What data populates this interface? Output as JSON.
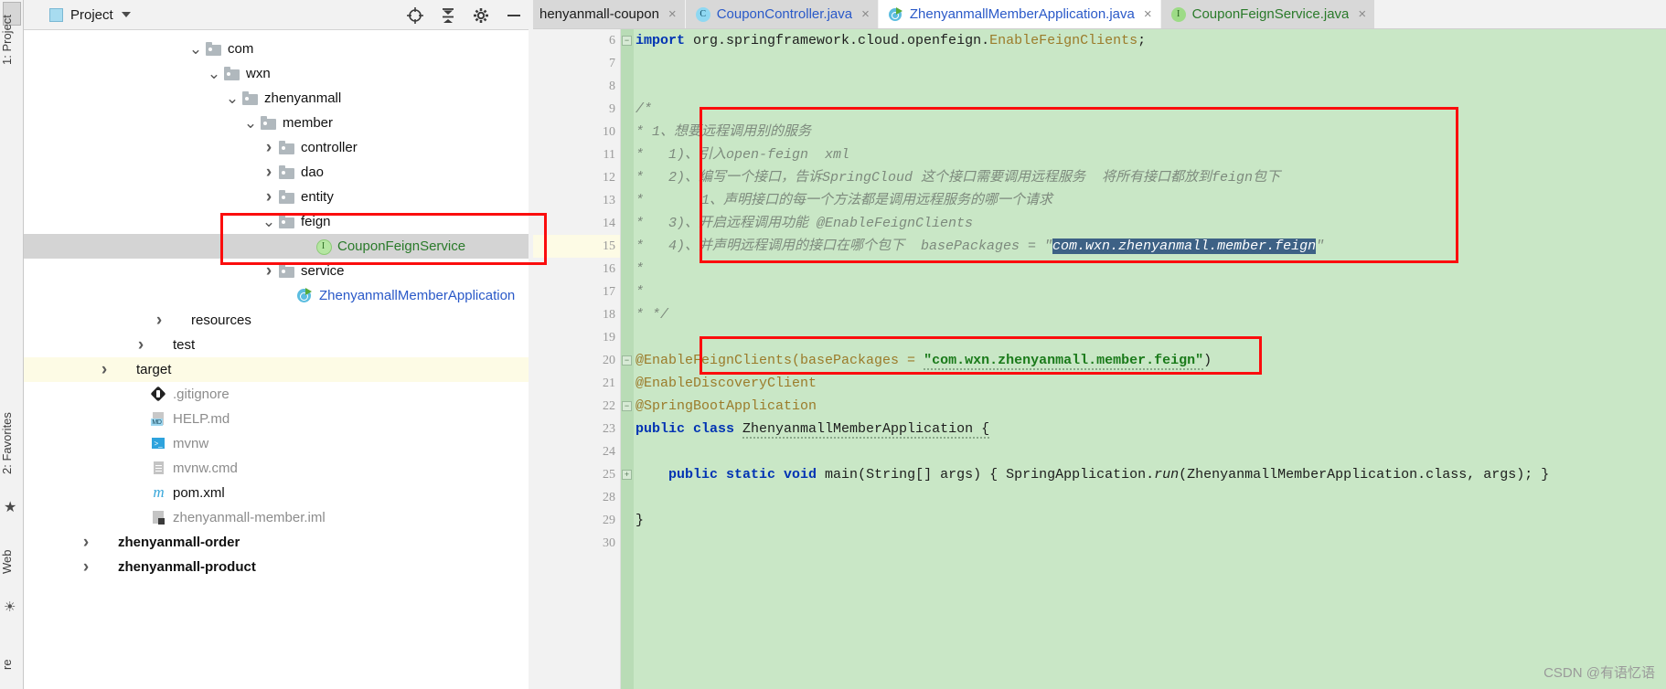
{
  "left_strip": {
    "project_label": "1: Project",
    "favorites_label": "2: Favorites",
    "web_label": "Web",
    "structure_label": "re",
    "star_icon": "star-icon",
    "globe_icon": "globe-icon"
  },
  "project_panel": {
    "title": "Project",
    "dropdown_icon": "chevron-down-icon",
    "actions": [
      {
        "name": "locate-icon",
        "glyph": "⊕"
      },
      {
        "name": "collapse-all-icon",
        "glyph": "⇹"
      },
      {
        "name": "settings-gear-icon",
        "glyph": "⚙"
      },
      {
        "name": "hide-panel-icon",
        "glyph": "—"
      }
    ],
    "tree": [
      {
        "label": "com",
        "indent": 9,
        "arrow": "down",
        "icon": "folder",
        "color": "",
        "state": ""
      },
      {
        "label": "wxn",
        "indent": 10,
        "arrow": "down",
        "icon": "folder",
        "color": "",
        "state": ""
      },
      {
        "label": "zhenyanmall",
        "indent": 11,
        "arrow": "down",
        "icon": "folder",
        "color": "",
        "state": ""
      },
      {
        "label": "member",
        "indent": 12,
        "arrow": "down",
        "icon": "folder",
        "color": "",
        "state": ""
      },
      {
        "label": "controller",
        "indent": 13,
        "arrow": "right",
        "icon": "folder",
        "color": "",
        "state": ""
      },
      {
        "label": "dao",
        "indent": 13,
        "arrow": "right",
        "icon": "folder",
        "color": "",
        "state": ""
      },
      {
        "label": "entity",
        "indent": 13,
        "arrow": "right",
        "icon": "folder",
        "color": "",
        "state": ""
      },
      {
        "label": "feign",
        "indent": 13,
        "arrow": "down",
        "icon": "folder",
        "color": "",
        "state": ""
      },
      {
        "label": "CouponFeignService",
        "indent": 15,
        "arrow": "none",
        "icon": "iface",
        "color": "green",
        "state": "selected"
      },
      {
        "label": "service",
        "indent": 13,
        "arrow": "right",
        "icon": "folder",
        "color": "",
        "state": ""
      },
      {
        "label": "ZhenyanmallMemberApplication",
        "indent": 14,
        "arrow": "none",
        "icon": "spring",
        "color": "blue",
        "state": ""
      },
      {
        "label": "resources",
        "indent": 7,
        "arrow": "right",
        "icon": "folder-res",
        "color": "",
        "state": ""
      },
      {
        "label": "test",
        "indent": 6,
        "arrow": "right",
        "icon": "folder-plain",
        "color": "",
        "state": ""
      },
      {
        "label": "target",
        "indent": 4,
        "arrow": "right",
        "icon": "folder-orange",
        "color": "",
        "state": "highlight"
      },
      {
        "label": ".gitignore",
        "indent": 6,
        "arrow": "none",
        "icon": "git",
        "color": "grey",
        "state": ""
      },
      {
        "label": "HELP.md",
        "indent": 6,
        "arrow": "none",
        "icon": "md",
        "color": "grey",
        "state": ""
      },
      {
        "label": "mvnw",
        "indent": 6,
        "arrow": "none",
        "icon": "sh",
        "color": "grey",
        "state": ""
      },
      {
        "label": "mvnw.cmd",
        "indent": 6,
        "arrow": "none",
        "icon": "file",
        "color": "grey",
        "state": ""
      },
      {
        "label": "pom.xml",
        "indent": 6,
        "arrow": "none",
        "icon": "maven",
        "color": "",
        "state": ""
      },
      {
        "label": "zhenyanmall-member.iml",
        "indent": 6,
        "arrow": "none",
        "icon": "iml",
        "color": "grey",
        "state": ""
      },
      {
        "label": "zhenyanmall-order",
        "indent": 3,
        "arrow": "right",
        "icon": "folder-mod",
        "color": "bold",
        "state": ""
      },
      {
        "label": "zhenyanmall-product",
        "indent": 3,
        "arrow": "right",
        "icon": "folder-mod",
        "color": "bold",
        "state": ""
      }
    ],
    "md_badge": "MD",
    "sh_badge": ">_",
    "maven_badge": "m",
    "iface_badge": "I"
  },
  "editor": {
    "tabs": [
      {
        "label": "henyanmall-coupon",
        "icon": "none",
        "active": false,
        "color": ""
      },
      {
        "label": "CouponController.java",
        "icon": "class-icon",
        "active": false,
        "color": "blue"
      },
      {
        "label": "ZhenyanmallMemberApplication.java",
        "icon": "spring-boot-icon",
        "active": true,
        "color": "blue"
      },
      {
        "label": "CouponFeignService.java",
        "icon": "interface-icon",
        "active": false,
        "color": "green"
      }
    ],
    "tab_close_glyph": "×",
    "class_badge": "C",
    "interface_badge": "I",
    "line_numbers": [
      "6",
      "7",
      "8",
      "9",
      "10",
      "11",
      "12",
      "13",
      "14",
      "15",
      "16",
      "17",
      "18",
      "19",
      "20",
      "21",
      "22",
      "23",
      "24",
      "25",
      "28",
      "29",
      "30"
    ],
    "code": [
      {
        "n": "6",
        "type": "import",
        "text": "import org.springframework.cloud.openfeign.EnableFeignClients;"
      },
      {
        "n": "7",
        "type": "blank",
        "text": ""
      },
      {
        "n": "8",
        "type": "blank",
        "text": ""
      },
      {
        "n": "9",
        "type": "comment",
        "text": "/*"
      },
      {
        "n": "10",
        "type": "comment",
        "text": "* 1、想要远程调用别的服务"
      },
      {
        "n": "11",
        "type": "comment",
        "text": "*   1)、引入open-feign  xml"
      },
      {
        "n": "12",
        "type": "comment",
        "text": "*   2)、编写一个接口，告诉SpringCloud 这个接口需要调用远程服务  将所有接口都放到feign包下"
      },
      {
        "n": "13",
        "type": "comment",
        "text": "*       1、声明接口的每一个方法都是调用远程服务的哪一个请求"
      },
      {
        "n": "14",
        "type": "comment",
        "text": "*   3)、开启远程调用功能 @EnableFeignClients"
      },
      {
        "n": "15",
        "type": "comment-sel",
        "text": "*   4)、并声明远程调用的接口在哪个包下  basePackages = \"",
        "selected": "com.wxn.zhenyanmall.member.feign",
        "tail": "\""
      },
      {
        "n": "16",
        "type": "comment",
        "text": "*"
      },
      {
        "n": "17",
        "type": "comment",
        "text": "*"
      },
      {
        "n": "18",
        "type": "comment",
        "text": "* */"
      },
      {
        "n": "19",
        "type": "blank",
        "text": ""
      },
      {
        "n": "20",
        "type": "annotation",
        "text": "@EnableFeignClients(basePackages = ",
        "string": "\"com.wxn.zhenyanmall.member.feign\"",
        "tail": ")"
      },
      {
        "n": "21",
        "type": "annotation",
        "text": "@EnableDiscoveryClient"
      },
      {
        "n": "22",
        "type": "annotation",
        "text": "@SpringBootApplication"
      },
      {
        "n": "23",
        "type": "class-decl",
        "kw": "public class ",
        "name": "ZhenyanmallMemberApplication {"
      },
      {
        "n": "24",
        "type": "blank",
        "text": ""
      },
      {
        "n": "25",
        "type": "method",
        "kw": "public static void ",
        "name": "main",
        "args": "(String[] args) { SpringApplication.",
        "run": "run",
        "tail": "(ZhenyanmallMemberApplication.class, args); }"
      },
      {
        "n": "28",
        "type": "blank",
        "text": ""
      },
      {
        "n": "29",
        "type": "brace",
        "text": "}"
      },
      {
        "n": "30",
        "type": "blank",
        "text": ""
      }
    ],
    "gutter_icons": {
      "bean": "spring-bean-icon",
      "run": "run-triangle-icon",
      "fold": "fold-minus-icon"
    }
  },
  "annotations": {
    "red_box_tree": "red-highlight-box-tree",
    "red_box_comment": "red-highlight-box-comment",
    "red_box_annotation": "red-highlight-box-annotation",
    "accent_red": "#fb0d0d",
    "comment_bg": "#c9e7c6",
    "selection_blue": "#3d6185"
  },
  "watermark": {
    "text": "CSDN @有语忆语"
  }
}
